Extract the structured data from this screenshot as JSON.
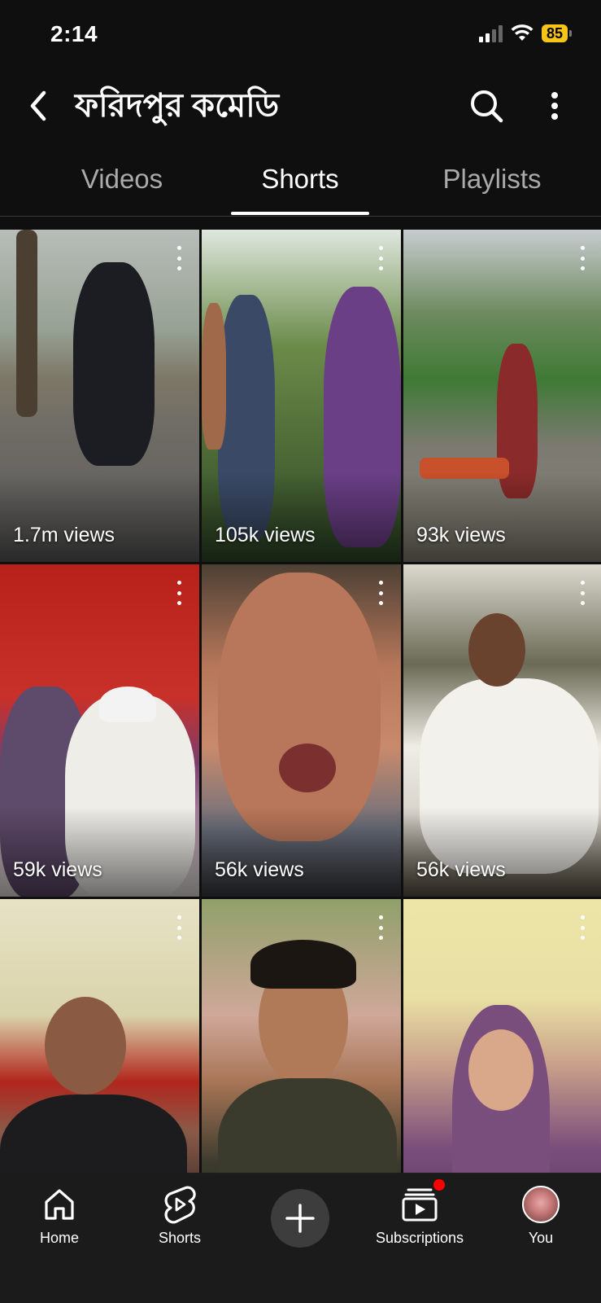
{
  "status_bar": {
    "time": "2:14",
    "battery": "85",
    "icons": [
      "signal-icon",
      "wifi-icon",
      "battery-icon"
    ]
  },
  "header": {
    "back_icon": "chevron-left-icon",
    "title": "ফরিদপুর কমেডি",
    "search_icon": "search-icon",
    "more_icon": "more-vertical-icon"
  },
  "tabs": [
    {
      "label": "Videos",
      "active": false
    },
    {
      "label": "Shorts",
      "active": true
    },
    {
      "label": "Playlists",
      "active": false
    }
  ],
  "shorts": [
    {
      "views": "1.7m views"
    },
    {
      "views": "105k views"
    },
    {
      "views": "93k views"
    },
    {
      "views": "59k views"
    },
    {
      "views": "56k views"
    },
    {
      "views": "56k views"
    },
    {
      "views": ""
    },
    {
      "views": ""
    },
    {
      "views": ""
    }
  ],
  "bottom_nav": {
    "home": "Home",
    "shorts": "Shorts",
    "create_icon": "plus-icon",
    "subscriptions": "Subscriptions",
    "you": "You"
  },
  "colors": {
    "background": "#0f0f0f",
    "battery": "#f5c518",
    "notification_dot": "#ff0000"
  }
}
